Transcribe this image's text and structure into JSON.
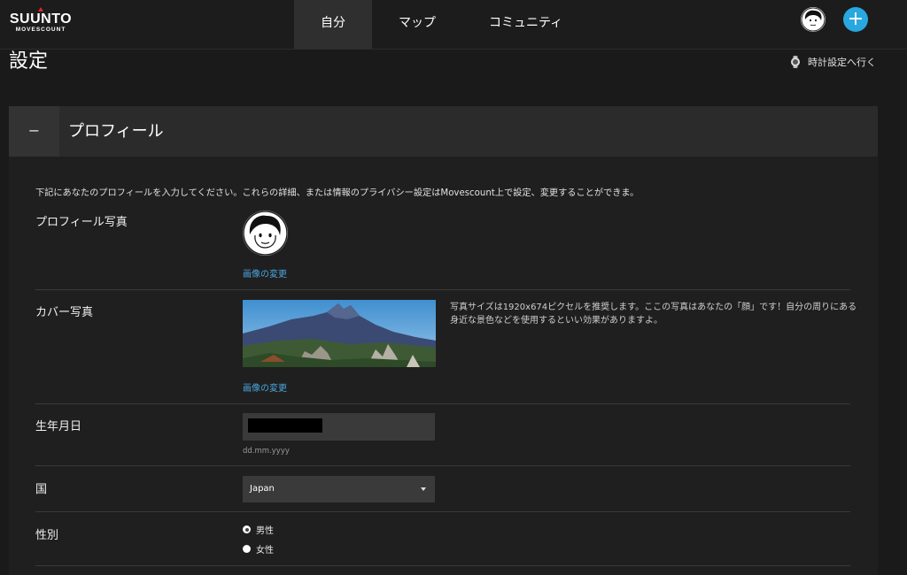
{
  "brand": {
    "name": "SUUNTO",
    "sub": "MOVESCOUNT"
  },
  "nav": {
    "items": [
      "自分",
      "マップ",
      "コミュニティ"
    ],
    "active": "自分"
  },
  "page": {
    "title": "設定",
    "watch_link": "時計設定へ行く"
  },
  "profile": {
    "section_title": "プロフィール",
    "collapse_symbol": "−",
    "intro": "下記にあなたのプロフィールを入力してください。これらの詳細、または情報のプライバシー設定はMovescount上で設定、変更することができま。",
    "photo_label": "プロフィール写真",
    "photo_change": "画像の変更",
    "cover_label": "カバー写真",
    "cover_change": "画像の変更",
    "cover_help": "写真サイズは1920x674ピクセルを推奨します。ここの写真はあなたの「顔」です！自分の周りにある身近な景色などを使用するといい効果がありますよ。",
    "birthday_label": "生年月日",
    "birthday_hint": "dd.mm.yyyy",
    "country_label": "国",
    "country_value": "Japan",
    "gender_label": "性別",
    "gender_options": [
      "男性",
      "女性"
    ],
    "gender_selected": "男性"
  },
  "colors": {
    "accent": "#29a7df",
    "link": "#4aa8e0",
    "background": "#1a1a1a",
    "panel": "#1f1f1f",
    "header": "#2b2b2b"
  },
  "icons": {
    "add": "plus-icon",
    "watch": "watch-icon",
    "collapse": "minus-icon",
    "select": "chevron-down-icon"
  }
}
